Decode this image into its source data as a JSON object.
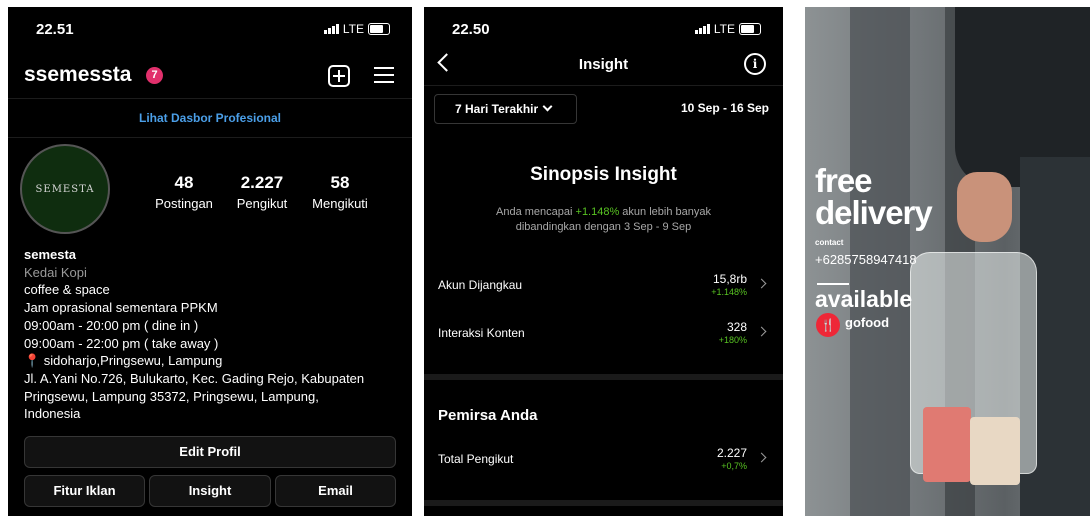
{
  "profile": {
    "status": {
      "time": "22.51",
      "network": "LTE"
    },
    "username": "ssemessta",
    "notification_count": "7",
    "dashboard_link": "Lihat Dasbor Profesional",
    "avatar_text": "SEMESTA",
    "stats": [
      {
        "value": "48",
        "label": "Postingan"
      },
      {
        "value": "2.227",
        "label": "Pengikut"
      },
      {
        "value": "58",
        "label": "Mengikuti"
      }
    ],
    "bio": {
      "name": "semesta",
      "category": "Kedai Kopi",
      "lines": [
        "coffee & space",
        "Jam oprasional sementara PPKM",
        "09:00am - 20:00 pm ( dine in )",
        "09:00am - 22:00 pm ( take away )",
        "📍 sidoharjo,Pringsewu, Lampung",
        "Jl. A.Yani No.726, Bulukarto, Kec. Gading Rejo, Kabupaten",
        "Pringsewu, Lampung 35372, Pringsewu, Lampung,",
        "Indonesia"
      ]
    },
    "buttons": {
      "edit": "Edit Profil",
      "ads": "Fitur Iklan",
      "insight": "Insight",
      "email": "Email"
    }
  },
  "insight": {
    "status": {
      "time": "22.50",
      "network": "LTE"
    },
    "title": "Insight",
    "period": "7 Hari Terakhir",
    "date_range": "10 Sep - 16 Sep",
    "synopsis_title": "Sinopsis Insight",
    "synopsis_pre": "Anda mencapai ",
    "synopsis_highlight": "+1.148%",
    "synopsis_post": " akun lebih banyak",
    "synopsis_line2": "dibandingkan dengan 3 Sep - 9 Sep",
    "rows": [
      {
        "label": "Akun Dijangkau",
        "value": "15,8rb",
        "change": "+1.148%"
      },
      {
        "label": "Interaksi Konten",
        "value": "328",
        "change": "+180%"
      }
    ],
    "audience_title": "Pemirsa Anda",
    "audience_rows": [
      {
        "label": "Total Pengikut",
        "value": "2.227",
        "change": "+0,7%"
      }
    ]
  },
  "promo": {
    "headline_1": "free",
    "headline_2": "delivery",
    "contact_label": "contact",
    "phone": "+6285758947418",
    "available": "available",
    "brand": "gofood"
  }
}
